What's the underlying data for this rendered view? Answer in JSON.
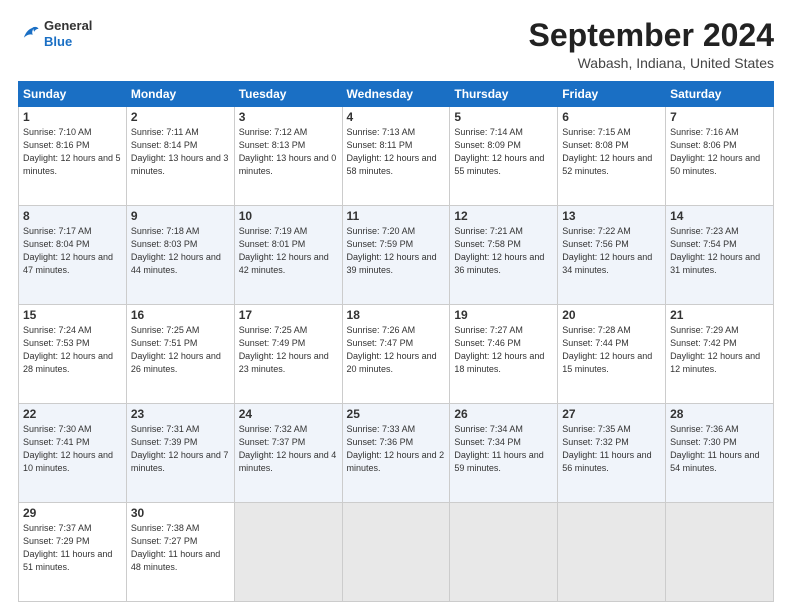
{
  "header": {
    "logo_general": "General",
    "logo_blue": "Blue",
    "month": "September 2024",
    "location": "Wabash, Indiana, United States"
  },
  "weekdays": [
    "Sunday",
    "Monday",
    "Tuesday",
    "Wednesday",
    "Thursday",
    "Friday",
    "Saturday"
  ],
  "weeks": [
    [
      {
        "day": "1",
        "sunrise": "Sunrise: 7:10 AM",
        "sunset": "Sunset: 8:16 PM",
        "daylight": "Daylight: 12 hours and 5 minutes."
      },
      {
        "day": "2",
        "sunrise": "Sunrise: 7:11 AM",
        "sunset": "Sunset: 8:14 PM",
        "daylight": "Daylight: 13 hours and 3 minutes."
      },
      {
        "day": "3",
        "sunrise": "Sunrise: 7:12 AM",
        "sunset": "Sunset: 8:13 PM",
        "daylight": "Daylight: 13 hours and 0 minutes."
      },
      {
        "day": "4",
        "sunrise": "Sunrise: 7:13 AM",
        "sunset": "Sunset: 8:11 PM",
        "daylight": "Daylight: 12 hours and 58 minutes."
      },
      {
        "day": "5",
        "sunrise": "Sunrise: 7:14 AM",
        "sunset": "Sunset: 8:09 PM",
        "daylight": "Daylight: 12 hours and 55 minutes."
      },
      {
        "day": "6",
        "sunrise": "Sunrise: 7:15 AM",
        "sunset": "Sunset: 8:08 PM",
        "daylight": "Daylight: 12 hours and 52 minutes."
      },
      {
        "day": "7",
        "sunrise": "Sunrise: 7:16 AM",
        "sunset": "Sunset: 8:06 PM",
        "daylight": "Daylight: 12 hours and 50 minutes."
      }
    ],
    [
      {
        "day": "8",
        "sunrise": "Sunrise: 7:17 AM",
        "sunset": "Sunset: 8:04 PM",
        "daylight": "Daylight: 12 hours and 47 minutes."
      },
      {
        "day": "9",
        "sunrise": "Sunrise: 7:18 AM",
        "sunset": "Sunset: 8:03 PM",
        "daylight": "Daylight: 12 hours and 44 minutes."
      },
      {
        "day": "10",
        "sunrise": "Sunrise: 7:19 AM",
        "sunset": "Sunset: 8:01 PM",
        "daylight": "Daylight: 12 hours and 42 minutes."
      },
      {
        "day": "11",
        "sunrise": "Sunrise: 7:20 AM",
        "sunset": "Sunset: 7:59 PM",
        "daylight": "Daylight: 12 hours and 39 minutes."
      },
      {
        "day": "12",
        "sunrise": "Sunrise: 7:21 AM",
        "sunset": "Sunset: 7:58 PM",
        "daylight": "Daylight: 12 hours and 36 minutes."
      },
      {
        "day": "13",
        "sunrise": "Sunrise: 7:22 AM",
        "sunset": "Sunset: 7:56 PM",
        "daylight": "Daylight: 12 hours and 34 minutes."
      },
      {
        "day": "14",
        "sunrise": "Sunrise: 7:23 AM",
        "sunset": "Sunset: 7:54 PM",
        "daylight": "Daylight: 12 hours and 31 minutes."
      }
    ],
    [
      {
        "day": "15",
        "sunrise": "Sunrise: 7:24 AM",
        "sunset": "Sunset: 7:53 PM",
        "daylight": "Daylight: 12 hours and 28 minutes."
      },
      {
        "day": "16",
        "sunrise": "Sunrise: 7:25 AM",
        "sunset": "Sunset: 7:51 PM",
        "daylight": "Daylight: 12 hours and 26 minutes."
      },
      {
        "day": "17",
        "sunrise": "Sunrise: 7:25 AM",
        "sunset": "Sunset: 7:49 PM",
        "daylight": "Daylight: 12 hours and 23 minutes."
      },
      {
        "day": "18",
        "sunrise": "Sunrise: 7:26 AM",
        "sunset": "Sunset: 7:47 PM",
        "daylight": "Daylight: 12 hours and 20 minutes."
      },
      {
        "day": "19",
        "sunrise": "Sunrise: 7:27 AM",
        "sunset": "Sunset: 7:46 PM",
        "daylight": "Daylight: 12 hours and 18 minutes."
      },
      {
        "day": "20",
        "sunrise": "Sunrise: 7:28 AM",
        "sunset": "Sunset: 7:44 PM",
        "daylight": "Daylight: 12 hours and 15 minutes."
      },
      {
        "day": "21",
        "sunrise": "Sunrise: 7:29 AM",
        "sunset": "Sunset: 7:42 PM",
        "daylight": "Daylight: 12 hours and 12 minutes."
      }
    ],
    [
      {
        "day": "22",
        "sunrise": "Sunrise: 7:30 AM",
        "sunset": "Sunset: 7:41 PM",
        "daylight": "Daylight: 12 hours and 10 minutes."
      },
      {
        "day": "23",
        "sunrise": "Sunrise: 7:31 AM",
        "sunset": "Sunset: 7:39 PM",
        "daylight": "Daylight: 12 hours and 7 minutes."
      },
      {
        "day": "24",
        "sunrise": "Sunrise: 7:32 AM",
        "sunset": "Sunset: 7:37 PM",
        "daylight": "Daylight: 12 hours and 4 minutes."
      },
      {
        "day": "25",
        "sunrise": "Sunrise: 7:33 AM",
        "sunset": "Sunset: 7:36 PM",
        "daylight": "Daylight: 12 hours and 2 minutes."
      },
      {
        "day": "26",
        "sunrise": "Sunrise: 7:34 AM",
        "sunset": "Sunset: 7:34 PM",
        "daylight": "Daylight: 11 hours and 59 minutes."
      },
      {
        "day": "27",
        "sunrise": "Sunrise: 7:35 AM",
        "sunset": "Sunset: 7:32 PM",
        "daylight": "Daylight: 11 hours and 56 minutes."
      },
      {
        "day": "28",
        "sunrise": "Sunrise: 7:36 AM",
        "sunset": "Sunset: 7:30 PM",
        "daylight": "Daylight: 11 hours and 54 minutes."
      }
    ],
    [
      {
        "day": "29",
        "sunrise": "Sunrise: 7:37 AM",
        "sunset": "Sunset: 7:29 PM",
        "daylight": "Daylight: 11 hours and 51 minutes."
      },
      {
        "day": "30",
        "sunrise": "Sunrise: 7:38 AM",
        "sunset": "Sunset: 7:27 PM",
        "daylight": "Daylight: 11 hours and 48 minutes."
      },
      null,
      null,
      null,
      null,
      null
    ]
  ]
}
